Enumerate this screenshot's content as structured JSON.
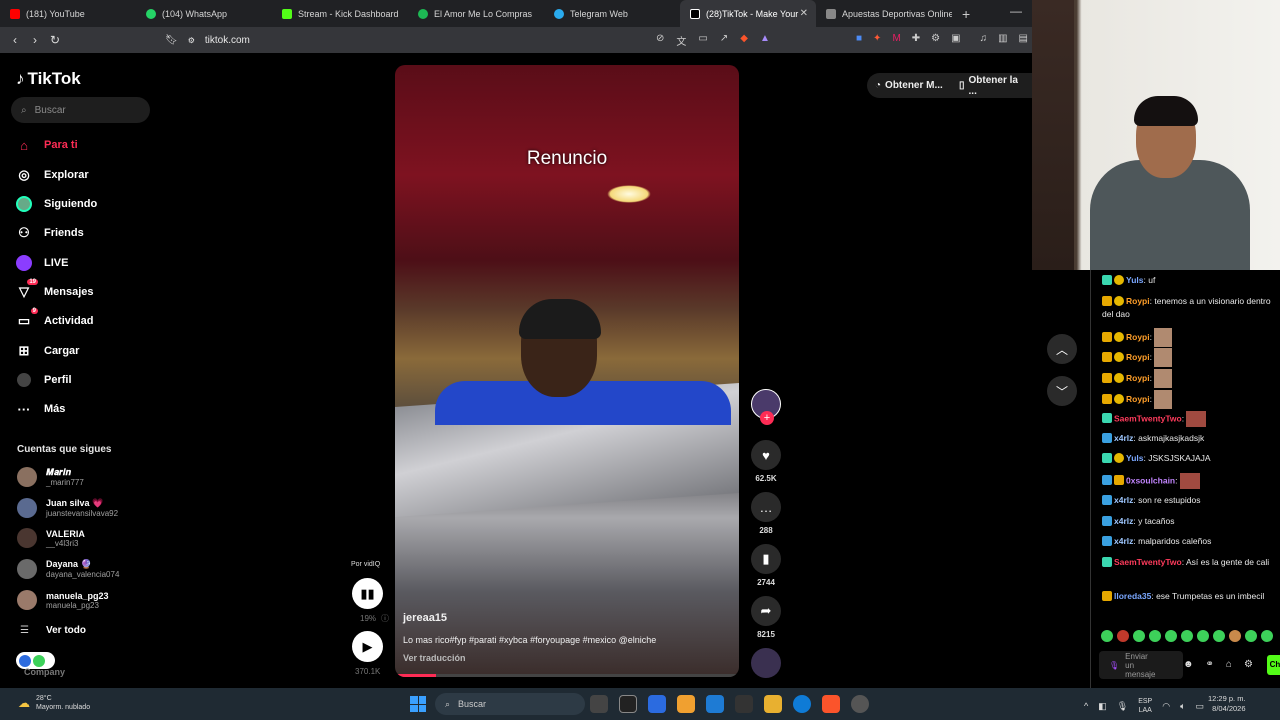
{
  "browser": {
    "tabs": [
      {
        "label": "(181) YouTube",
        "color": "#ff0000"
      },
      {
        "label": "(104) WhatsApp",
        "color": "#25d366"
      },
      {
        "label": "Stream - Kick Dashboard",
        "color": "#53fc18"
      },
      {
        "label": "El Amor Me Lo Compras",
        "color": "#1db954"
      },
      {
        "label": "Telegram Web",
        "color": "#2aabee"
      },
      {
        "label": "(28)TikTok - Make Your",
        "color": "#ffffff",
        "active": true
      },
      {
        "label": "Apuestas Deportivas Online",
        "color": "#888888"
      }
    ],
    "new_tab": "+",
    "url": "tiktok.com",
    "icons": {
      "back": "back-arrow-icon",
      "forward": "forward-arrow-icon",
      "reload": "reload-icon",
      "bookmark": "bookmark-icon"
    }
  },
  "sidebar": {
    "logo": "TikTok",
    "search_placeholder": "Buscar",
    "nav": [
      {
        "label": "Para ti",
        "icon": "home-icon",
        "glyph": "⌂",
        "active": true
      },
      {
        "label": "Explorar",
        "icon": "compass-icon",
        "glyph": "◎"
      },
      {
        "label": "Siguiendo",
        "icon": "following-avatar-icon",
        "glyph": "●"
      },
      {
        "label": "Friends",
        "icon": "friends-icon",
        "glyph": "⚇"
      },
      {
        "label": "LIVE",
        "icon": "live-icon",
        "glyph": "◉"
      },
      {
        "label": "Mensajes",
        "icon": "messages-icon",
        "glyph": "▽",
        "badge": "19"
      },
      {
        "label": "Actividad",
        "icon": "activity-icon",
        "glyph": "▭",
        "badge": "9"
      },
      {
        "label": "Cargar",
        "icon": "upload-icon",
        "glyph": "⊞"
      },
      {
        "label": "Perfil",
        "icon": "profile-icon",
        "glyph": "●"
      },
      {
        "label": "Más",
        "icon": "more-icon",
        "glyph": "···"
      }
    ],
    "following_title": "Cuentas que sigues",
    "accounts": [
      {
        "name": "𝑴𝒂𝒓𝒊𝒏",
        "handle": "_marin777"
      },
      {
        "name": "Juan silva 💗",
        "handle": "juanstevansilvava92"
      },
      {
        "name": "VALERIA",
        "handle": "__v4l3ri3"
      },
      {
        "name": "Dayana 🔮",
        "handle": "dayana_valencia074"
      },
      {
        "name": "manuela_pg23",
        "handle": "manuela_pg23"
      }
    ],
    "see_all": "Ver todo",
    "company": "Company"
  },
  "video": {
    "overlay_title": "Renuncio",
    "author": "jereaa15",
    "description": "Lo mas rico#fyp #parati #xybca #foryoupage #mexico @elniche",
    "translate": "Ver traducción",
    "progress": 0.12
  },
  "actions": {
    "likes": "62.5K",
    "comments": "288",
    "saves": "2744",
    "shares": "8215"
  },
  "vidiq": {
    "label": "Por vidIQ",
    "percent": "19%",
    "count": "370.1K"
  },
  "top_buttons": {
    "get_app": "Obtener M...",
    "get_desktop": "Obtener la ..."
  },
  "chat": {
    "messages": [
      {
        "user": "Yuls",
        "text": "uf",
        "color": "#7aa7ff"
      },
      {
        "user": "Roypi",
        "text": "tenemos a un visionario dentro del dao",
        "color": "#ff9f29"
      },
      {
        "user": "Roypi",
        "text": "",
        "color": "#ff9f29",
        "emote": true
      },
      {
        "user": "Roypi",
        "text": "",
        "color": "#ff9f29",
        "emote": true
      },
      {
        "user": "Roypi",
        "text": "",
        "color": "#ff9f29",
        "emote": true
      },
      {
        "user": "Roypi",
        "text": "",
        "color": "#ff9f29",
        "emote": true
      },
      {
        "user": "SaemTwentyTwo",
        "text": "",
        "color": "#ff3b5c",
        "emote2": true
      },
      {
        "user": "x4rlz",
        "text": "askmajkasjkadsjk",
        "color": "#9ec7ff"
      },
      {
        "user": "Yuls",
        "text": "JSKSJSKAJAJA",
        "color": "#7aa7ff"
      },
      {
        "user": "0xsoulchain",
        "text": "",
        "color": "#c084fc",
        "emote2": true
      },
      {
        "user": "x4rlz",
        "text": "son re estupidos",
        "color": "#9ec7ff"
      },
      {
        "user": "x4rlz",
        "text": "y tacaños",
        "color": "#9ec7ff"
      },
      {
        "user": "x4rlz",
        "text": "malparidos caleños",
        "color": "#9ec7ff"
      },
      {
        "user": "SaemTwentyTwo",
        "text": "Así es la gente de cali",
        "color": "#ff3b5c"
      },
      {
        "user": "lloreda35",
        "text": "ese Trumpetas es un imbecil",
        "color": "#7aa7ff"
      }
    ],
    "input_placeholder": "Enviar un mensaje",
    "send_label": "Ch"
  },
  "taskbar": {
    "temp": "28°C",
    "weather": "Mayorm. nublado",
    "search": "Buscar",
    "lang": "ESP",
    "lang2": "LAA",
    "time": "12:29 p. m.",
    "date": "8/04/2026"
  }
}
